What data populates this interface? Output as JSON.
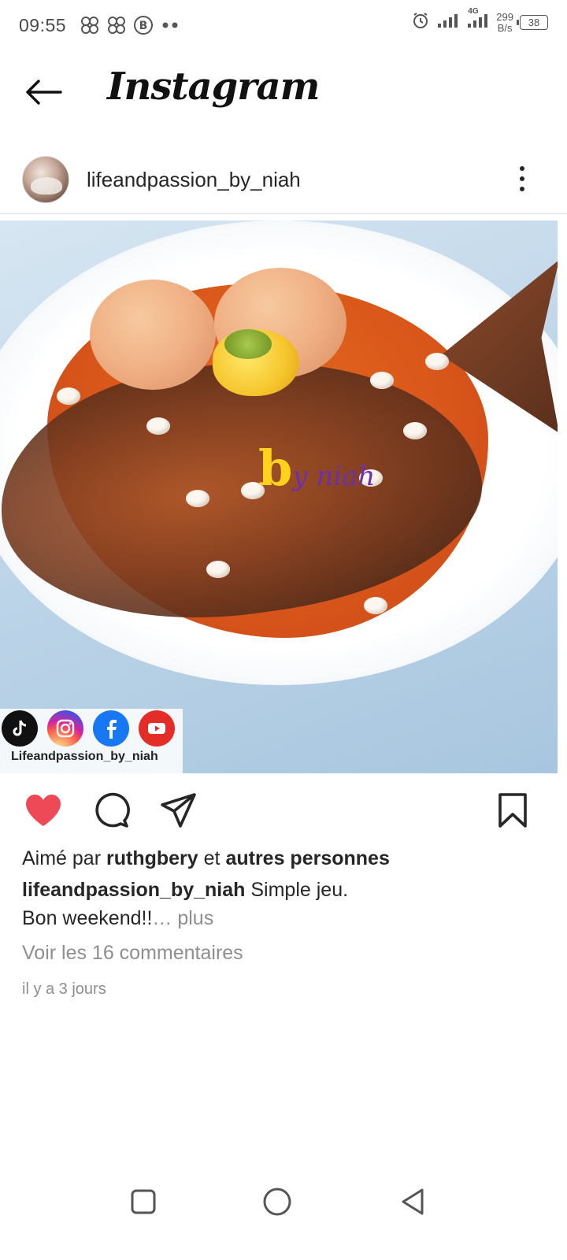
{
  "status_bar": {
    "time": "09:55",
    "left_icons": [
      "pinwheel-icon",
      "pinwheel-icon",
      "b-circle-icon",
      "dots-icon"
    ],
    "net_speed_value": "299",
    "net_speed_unit": "B/s",
    "network": "4G",
    "battery": "38"
  },
  "app_header": {
    "brand": "Instagram",
    "back_icon": "arrow-left-icon"
  },
  "post": {
    "username": "lifeandpassion_by_niah",
    "image_watermark_b": "b",
    "image_watermark_text": "y niah",
    "social_handle": "Lifeandpassion_by_niah",
    "social_icons": [
      "tiktok-icon",
      "instagram-icon",
      "facebook-icon",
      "youtube-icon"
    ]
  },
  "actions": {
    "like": "heart-icon",
    "comment": "comment-icon",
    "share": "send-icon",
    "save": "bookmark-icon",
    "like_color": "#ed4956"
  },
  "caption": {
    "likes_prefix": "Aimé par",
    "likes_user": "ruthgbery",
    "likes_mid": "et",
    "likes_others": "autres personnes",
    "author": "lifeandpassion_by_niah",
    "text_line1": "Simple jeu.",
    "text_line2": "Bon weekend!!",
    "more": "… plus",
    "comments_link": "Voir les 16 commentaires",
    "timestamp": "il y a 3 jours"
  },
  "nav": {
    "recent": "square-icon",
    "home": "circle-icon",
    "back": "triangle-back-icon"
  }
}
